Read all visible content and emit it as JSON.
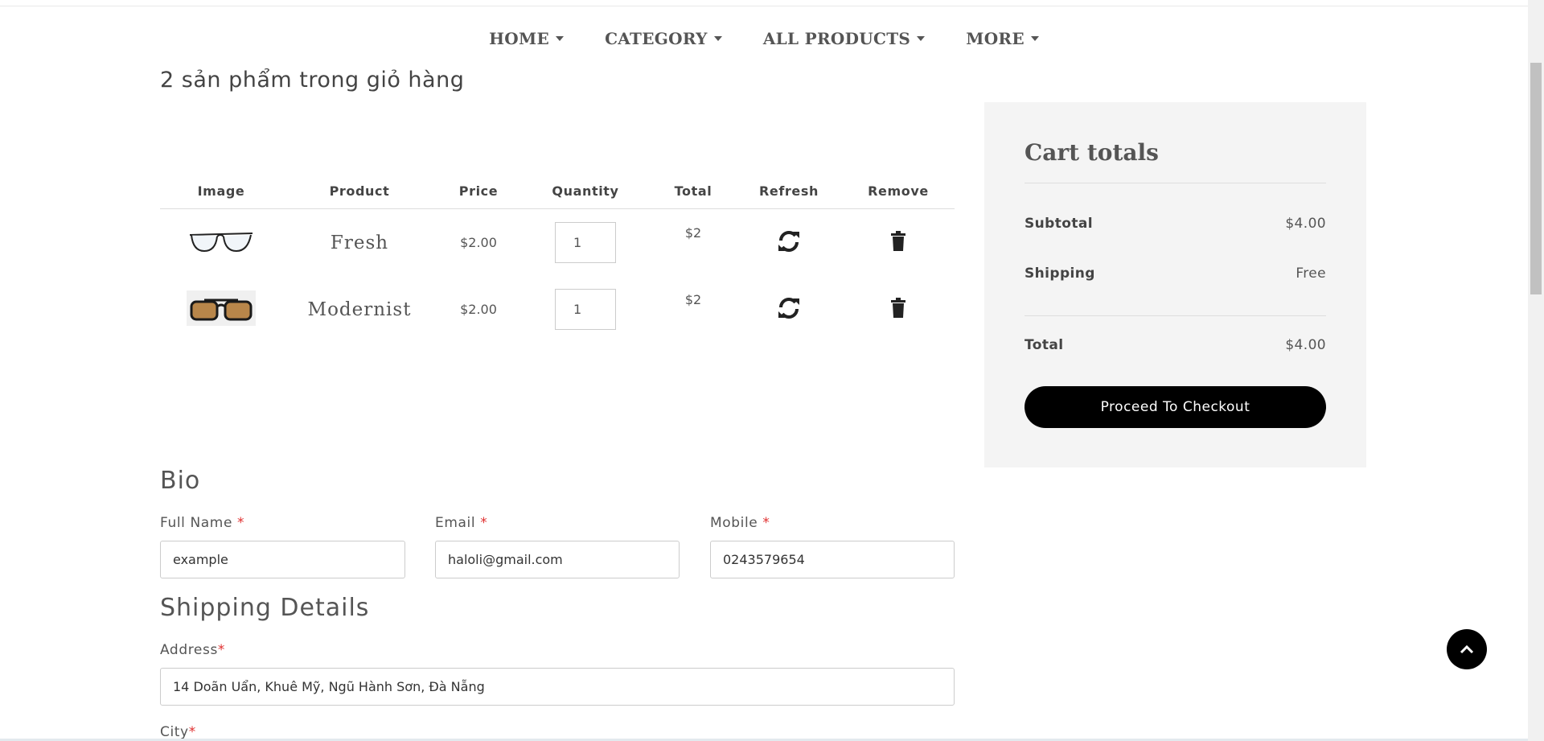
{
  "nav": {
    "items": [
      {
        "label": "HOME"
      },
      {
        "label": "CATEGORY"
      },
      {
        "label": "ALL PRODUCTS"
      },
      {
        "label": "MORE"
      }
    ]
  },
  "cart": {
    "heading": "2 sản phẩm trong giỏ hàng",
    "columns": [
      "Image",
      "Product",
      "Price",
      "Quantity",
      "Total",
      "Refresh",
      "Remove"
    ],
    "items": [
      {
        "image_icon": "eyeglasses-image",
        "product": "Fresh",
        "price": "$2.00",
        "quantity": "1",
        "total": "$2"
      },
      {
        "image_icon": "sunglasses-image",
        "product": "Modernist",
        "price": "$2.00",
        "quantity": "1",
        "total": "$2"
      }
    ]
  },
  "totals": {
    "title": "Cart totals",
    "subtotal_label": "Subtotal",
    "subtotal_value": "$4.00",
    "shipping_label": "Shipping",
    "shipping_value": "Free",
    "total_label": "Total",
    "total_value": "$4.00",
    "checkout_label": "Proceed To Checkout"
  },
  "bio": {
    "title": "Bio",
    "full_name_label": "Full Name",
    "full_name_value": "example",
    "email_label": "Email",
    "email_value": "haloli@gmail.com",
    "mobile_label": "Mobile",
    "mobile_value": "0243579654",
    "required_mark": "*"
  },
  "shipping": {
    "title": "Shipping Details",
    "address_label": "Address",
    "address_value": "14 Doãn Uẩn, Khuê Mỹ, Ngũ Hành Sơn, Đà Nẵng",
    "city_label": "City",
    "required_mark": "*"
  },
  "colors": {
    "accent": "#000000",
    "required": "#e03030",
    "sidebar_bg": "#f4f4f4"
  }
}
